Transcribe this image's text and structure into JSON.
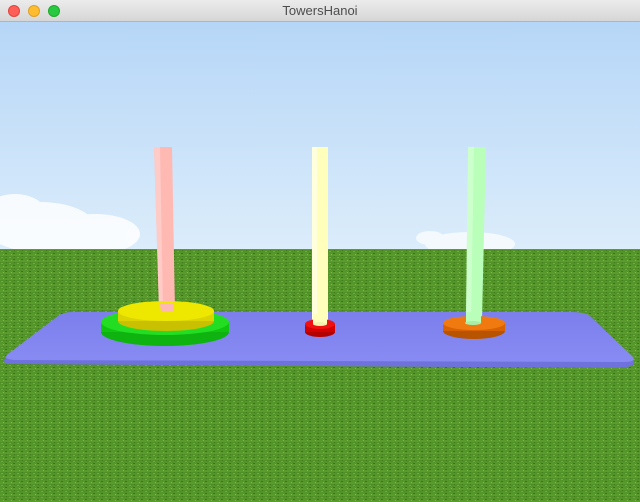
{
  "window": {
    "title": "TowersHanoi"
  },
  "colors": {
    "sky_top": "#b7d7f7",
    "sky_bottom": "#d9ecfb",
    "grass_dark": "#3f7a1f",
    "grass_light": "#63a532",
    "board": "#7f82ee",
    "peg_left": "#ffb9b3",
    "peg_middle": "#ffffbb",
    "peg_right": "#b9ffb9",
    "disk_yellow": "#e8e000",
    "disk_green": "#11cc11",
    "disk_red": "#e00000",
    "disk_orange": "#e46a00"
  },
  "game": {
    "pegs": [
      {
        "name": "left",
        "disks": [
          "green",
          "yellow"
        ]
      },
      {
        "name": "middle",
        "disks": [
          "red"
        ]
      },
      {
        "name": "right",
        "disks": [
          "orange"
        ]
      }
    ]
  }
}
